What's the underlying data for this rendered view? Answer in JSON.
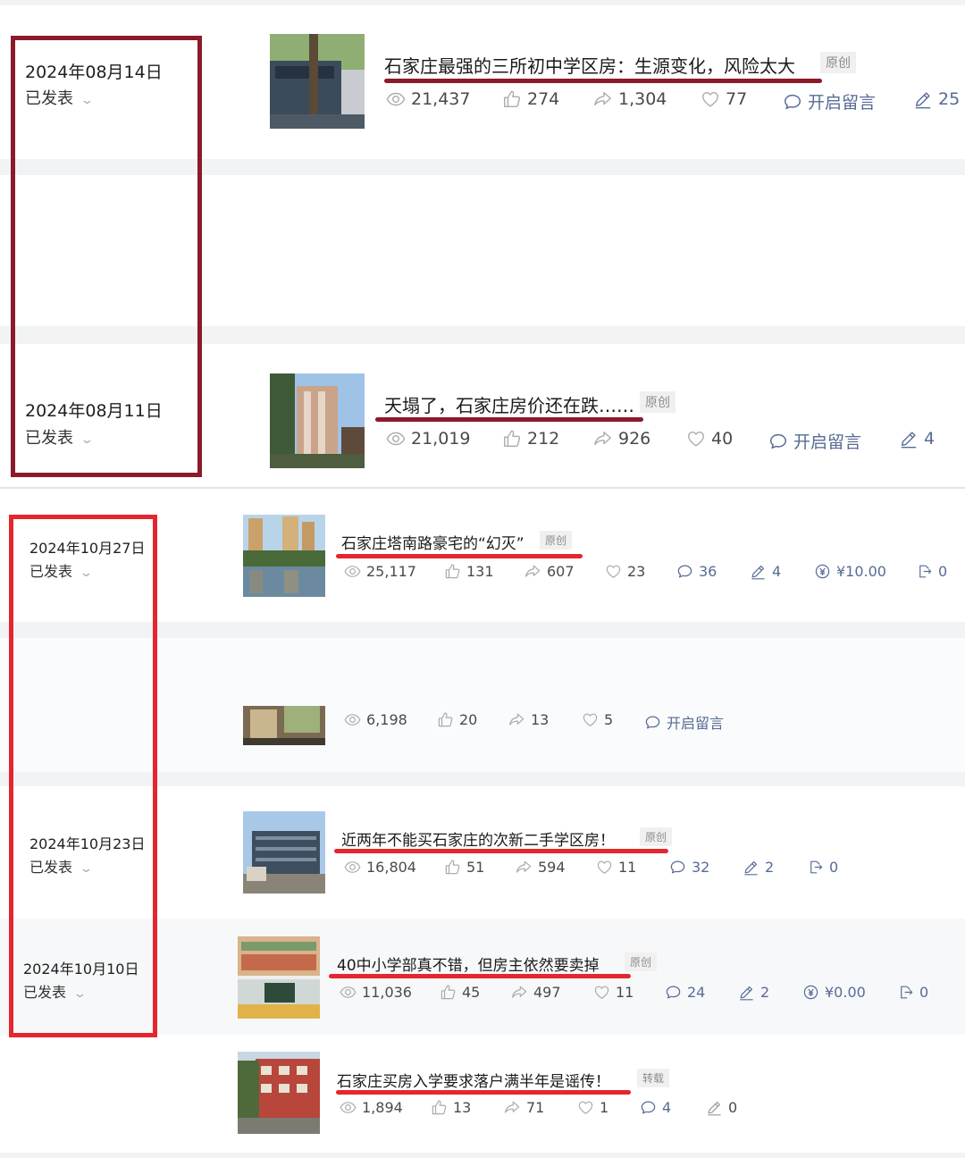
{
  "colors": {
    "frame_top": "#8b1a2a",
    "frame_bottom": "#e5262f",
    "underline_top": "#8b1a2a",
    "underline_bottom": "#e5262f",
    "link_blue": "#576b95",
    "band_gray": "#f4f5f7"
  },
  "articles": [
    {
      "date": "2024年08月14日",
      "status": "已发表",
      "title": "石家庄最强的三所初中学区房：生源变化，风险太大",
      "tag": "原创",
      "views": "21,437",
      "likes": "274",
      "shares": "1,304",
      "favs": "77",
      "comment": "开启留言",
      "edit": "25"
    },
    {
      "date": "2024年08月11日",
      "status": "已发表",
      "title": "天塌了，石家庄房价还在跌……",
      "tag": "原创",
      "views": "21,019",
      "likes": "212",
      "shares": "926",
      "favs": "40",
      "comment": "开启留言",
      "edit": "4"
    },
    {
      "date": "2024年10月27日",
      "status": "已发表",
      "title": "石家庄塔南路豪宅的“幻灭”",
      "tag": "原创",
      "views": "25,117",
      "likes": "131",
      "shares": "607",
      "favs": "23",
      "comments": "36",
      "edit": "4",
      "reward": "¥10.00",
      "share2": "0"
    },
    {
      "views": "6,198",
      "likes": "20",
      "shares": "13",
      "favs": "5",
      "comment": "开启留言"
    },
    {
      "date": "2024年10月23日",
      "status": "已发表",
      "title": "近两年不能买石家庄的次新二手学区房！",
      "tag": "原创",
      "views": "16,804",
      "likes": "51",
      "shares": "594",
      "favs": "11",
      "comments": "32",
      "edit": "2",
      "share2": "0"
    },
    {
      "date": "2024年10月10日",
      "status": "已发表",
      "title": "40中小学部真不错，但房主依然要卖掉",
      "tag": "原创",
      "views": "11,036",
      "likes": "45",
      "shares": "497",
      "favs": "11",
      "comments": "24",
      "edit": "2",
      "reward": "¥0.00",
      "share2": "0"
    },
    {
      "title": "石家庄买房入学要求落户满半年是谣传！",
      "tag": "转载",
      "views": "1,894",
      "likes": "13",
      "shares": "71",
      "favs": "1",
      "comments": "4",
      "edit": "0"
    }
  ]
}
